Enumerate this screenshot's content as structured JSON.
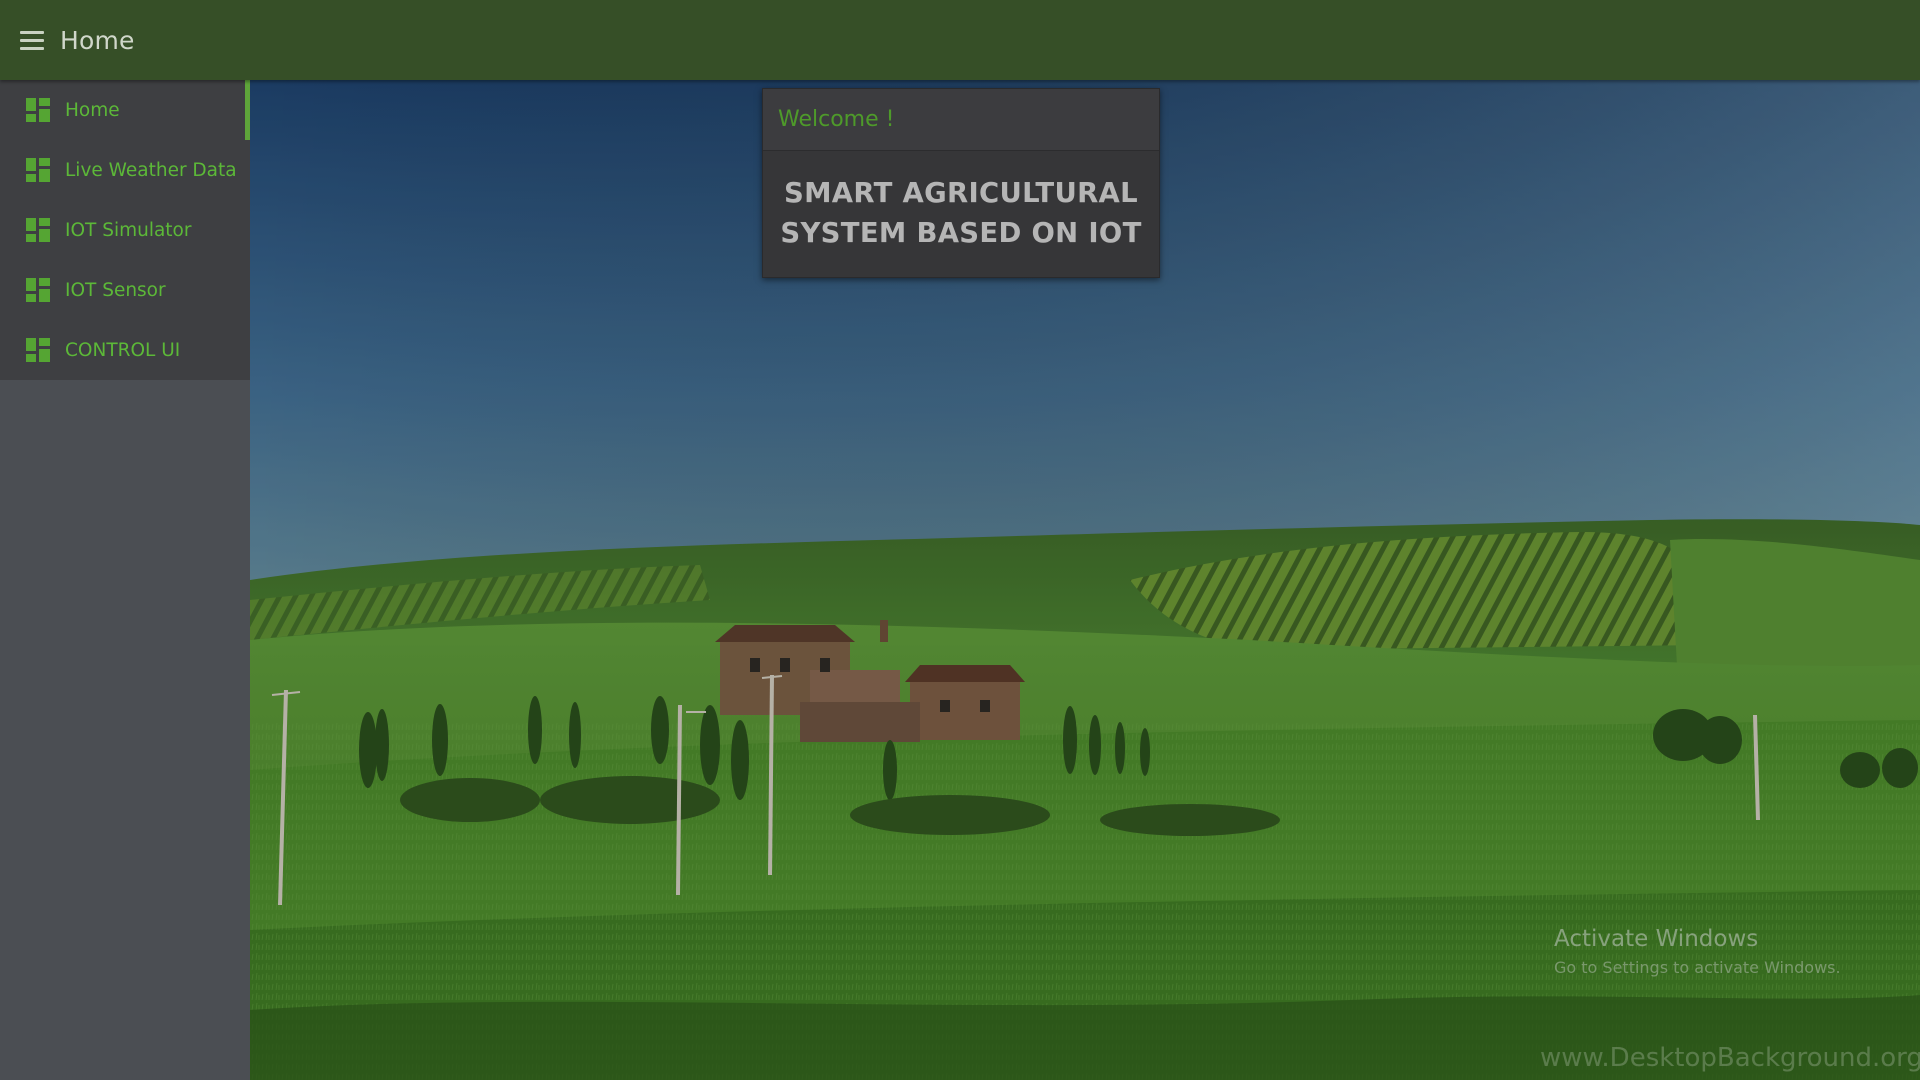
{
  "topbar": {
    "title": "Home",
    "color": "#364f27"
  },
  "sidebar": {
    "accent": "#5ea43a",
    "items": [
      {
        "label": "Home",
        "icon": "dashboard-icon",
        "active": true
      },
      {
        "label": "Live Weather Data",
        "icon": "dashboard-icon",
        "active": false
      },
      {
        "label": "IOT Simulator",
        "icon": "dashboard-icon",
        "active": false
      },
      {
        "label": "IOT Sensor",
        "icon": "dashboard-icon",
        "active": false
      },
      {
        "label": "CONTROL UI",
        "icon": "dashboard-icon",
        "active": false
      }
    ]
  },
  "welcome": {
    "title": "Welcome !",
    "line1": "SMART AGRICULTURAL",
    "line2": "SYSTEM BASED ON IOT"
  },
  "watermark": {
    "activate_title": "Activate Windows",
    "activate_sub": "Go to Settings to activate Windows.",
    "site": "www.DesktopBackground.org"
  }
}
